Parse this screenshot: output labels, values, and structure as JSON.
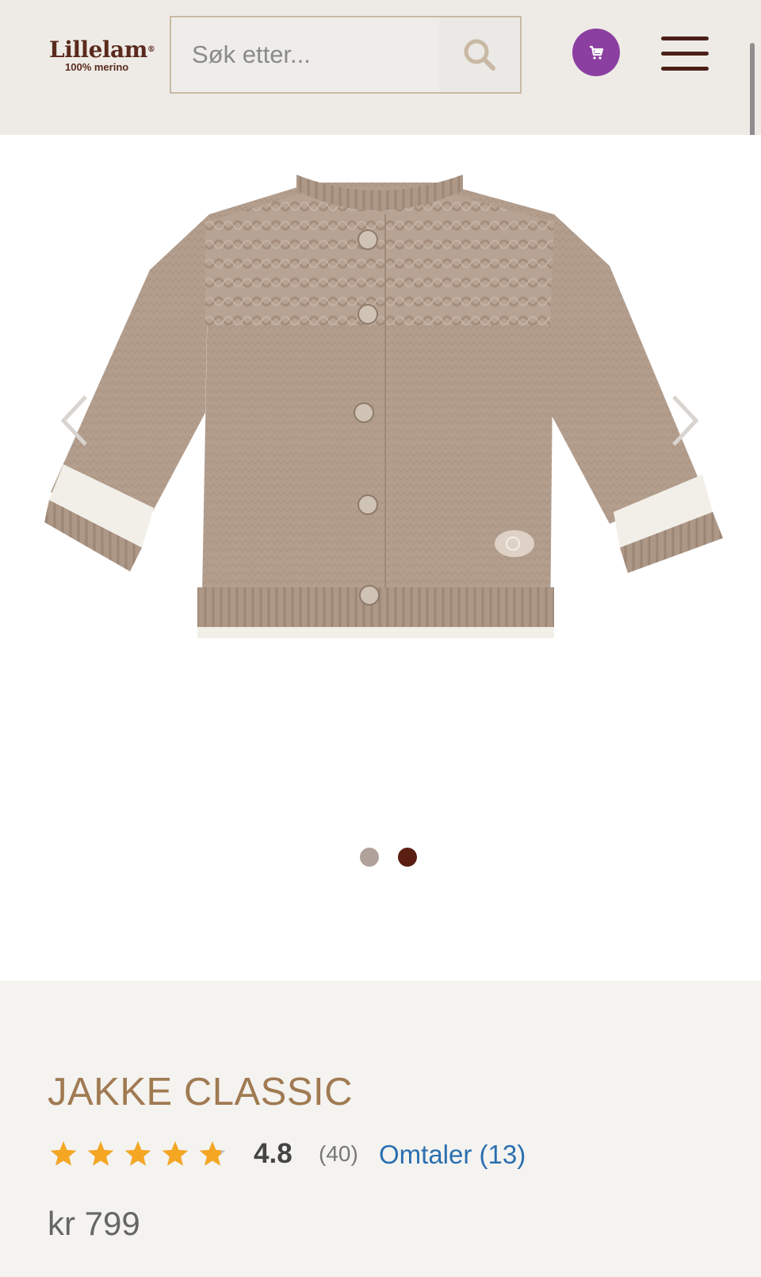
{
  "header": {
    "logo_name": "Lillelam",
    "logo_reg": "®",
    "logo_tagline": "100% merino",
    "search_placeholder": "Søk etter...",
    "search_icon": "search-icon",
    "cart_icon": "cart-icon",
    "menu_icon": "hamburger-menu-icon"
  },
  "gallery": {
    "image_alt": "product-image-cardigan",
    "prev_icon": "chevron-left-icon",
    "next_icon": "chevron-right-icon",
    "slide_count": 2,
    "active_slide": 2
  },
  "product": {
    "title": "JAKKE CLASSIC",
    "rating": 4.8,
    "rating_display": "4.8",
    "rating_count": "(40)",
    "reviews_link": "Omtaler (13)",
    "price": "kr 799"
  },
  "colors": {
    "header_bg": "#eeebe7",
    "brand_brown": "#5a2a1c",
    "cart_purple": "#8b3fa0",
    "title_tan": "#a07a52",
    "star_gold": "#f5a623",
    "link_blue": "#2a6fb0",
    "dot_inactive": "#b0a19b",
    "dot_active": "#5a1e12"
  }
}
